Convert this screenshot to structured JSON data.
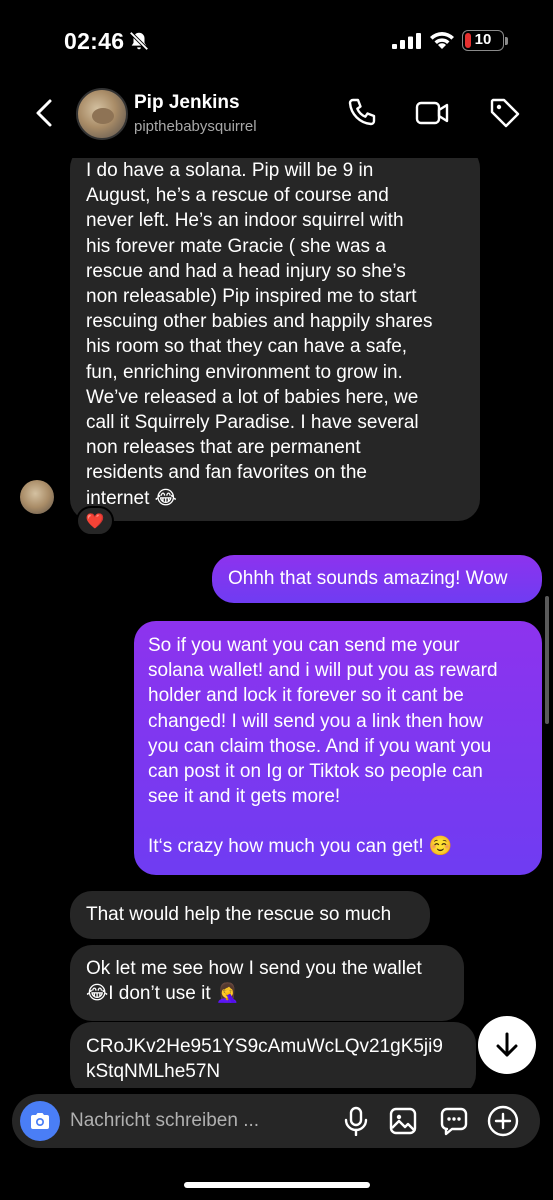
{
  "status_bar": {
    "time": "02:46",
    "battery_level": "10"
  },
  "header": {
    "name": "Pip Jenkins",
    "handle": "pipthebabysquirrel"
  },
  "messages": [
    {
      "sender": "contact",
      "text": "I do have a solana. Pip will be 9 in\nAugust, he’s a rescue of course and\nnever left. He’s an indoor squirrel with\nhis forever mate Gracie ( she was a\nrescue and had a head injury so she’s\nnon releasable) Pip inspired me to start\nrescuing other babies and happily shares\nhis room so that they can have a safe,\nfun, enriching environment to grow in.\nWe’ve released a lot of babies here, we\ncall it Squirrely Paradise. I have several\nnon releases that are permanent\nresidents and fan favorites on the\ninternet 😂",
      "reaction": "❤️"
    },
    {
      "sender": "me",
      "text": "Ohhh that sounds amazing! Wow"
    },
    {
      "sender": "me",
      "text_part1": "So if you want you can send me your\nsolana wallet! and i will put you as reward\nholder and lock it forever so it cant be\nchanged! I will send you a link then how\nyou can claim those. And if you want you\ncan post it on Ig or Tiktok so people can\nsee it and it gets more!",
      "text_part2": "It‘s crazy how much you can get! ☺️"
    },
    {
      "sender": "contact",
      "text": "That would help the rescue so much"
    },
    {
      "sender": "contact",
      "text": "Ok let me see how I send you the wallet\n😂I don’t use it 🤦‍♀️"
    },
    {
      "sender": "contact",
      "text": "CRoJKv2He951YS9cAmuWcLQv21gK5ji9\nkStqNMLhe57N"
    }
  ],
  "composer": {
    "placeholder": "Nachricht schreiben ..."
  },
  "icons": {
    "back": "chevron-left-icon",
    "call": "phone-icon",
    "video": "video-camera-icon",
    "tag": "tag-icon",
    "camera": "camera-icon",
    "mic": "microphone-icon",
    "gallery": "image-icon",
    "sticker": "sticker-chat-icon",
    "plus": "plus-circle-icon",
    "scroll_down": "arrow-down-icon"
  },
  "colors": {
    "background": "#000000",
    "incoming_bubble": "#262626",
    "outgoing_bubble_top": "#8d33ee",
    "outgoing_bubble_bottom": "#6f3cf2",
    "camera_button": "#4a7ef6",
    "battery_low": "#e5302f"
  }
}
